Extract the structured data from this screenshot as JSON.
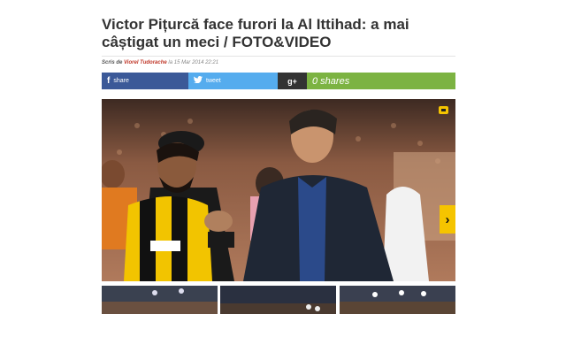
{
  "article": {
    "headline": "Victor Pițurcă face furori la Al Ittihad: a mai câștigat un meci / FOTO&VIDEO",
    "byline_label": "Scris de",
    "author": "Viorel Tudorache",
    "date_prefix": "la",
    "date": "15 Mar 2014 22:21"
  },
  "share": {
    "facebook_label": "share",
    "twitter_label": "tweet",
    "googleplus_label": "g+",
    "shares_count": "0 shares"
  },
  "gallery": {
    "main_image_alt": "Victor Pițurcă shaking hands with Al Ittihad player",
    "thumbnail_count": 3
  },
  "colors": {
    "facebook": "#3b5998",
    "twitter": "#55acee",
    "googleplus": "#333333",
    "shares": "#7cb342",
    "accent": "#f5c400"
  },
  "icons": {
    "facebook": "facebook-icon",
    "twitter": "twitter-icon",
    "googleplus": "googleplus-icon",
    "gallery": "gallery-icon",
    "next": "chevron-right-icon"
  }
}
